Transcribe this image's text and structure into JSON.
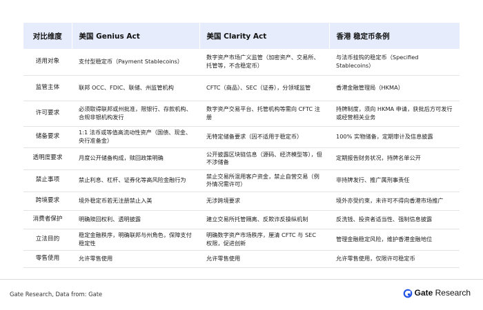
{
  "table": {
    "headers": [
      "对比维度",
      "美国 Genius Act",
      "美国 Clarity Act",
      "香港 稳定币条例"
    ],
    "rows": [
      [
        "适用对象",
        "支付型稳定币（Payment Stablecoins）",
        "数字资产市场广义监管（加密资产、交易所、托管等，不含稳定币）",
        "与法币挂钩的稳定币（Specified Stablecoins）"
      ],
      [
        "监管主体",
        "联邦 OCC、FDIC、联储、州监管机构",
        "CFTC（商品）、SEC（证券），分领域监管",
        "香港金融管理局（HKMA）"
      ],
      [
        "许可要求",
        "必须取得联邦或州批准，限银行、存款机构、合规非银机构发行",
        "数字资产交易平台、托管机构等需向 CFTC 注册",
        "持牌制度，须向 HKMA 申请，获批后方可发行或经营相关业务"
      ],
      [
        "储备要求",
        "1:1 法币或等值高流动性资产（国债、现金、央行准备金）",
        "无特定储备要求（因不适用于稳定币）",
        "100% 实物储备，定期审计及信息披露"
      ],
      [
        "透明度要求",
        "月度公开储备构成，赎回政策明确",
        "公开披露区块链信息（源码、经济模型等），但不涉储备",
        "定期报告财务状况，持牌名单公开"
      ],
      [
        "禁止事项",
        "禁止利息、杠杆、证券化等高风险金融行为",
        "禁止交易所混用客户资金，禁止自营交易（例外情况需许可）",
        "非持牌发行、推广属刑事责任"
      ],
      [
        "跨境要求",
        "境外稳定币若无注册禁止入美",
        "无涉跨境要求",
        "境外亦受约束，未许可不得向香港市场推广"
      ],
      [
        "消费者保护",
        "明确赎回权利、透明披露",
        "建立交易所托管隔离、反欺诈反操纵机制",
        "反洗钱、投资者适当性、强制信息披露"
      ],
      [
        "立法目的",
        "稳定金融秩序，明确联邦与州角色，保障支付稳定性",
        "明确数字资产市场秩序，厘清 CFTC 与 SEC 权限，促进创新",
        "管理金融稳定风险，维护香港金融地位"
      ],
      [
        "零售使用",
        "允许零售使用",
        "允许零售使用",
        "允许零售使用，仅限许可稳定币"
      ]
    ]
  },
  "footer": {
    "source": "Gate Research, Data from:  Gate",
    "brand_name": "Gate",
    "brand_suffix": " Research",
    "brand_icon": "gate-logo-icon",
    "brand_color": "#2354e6"
  }
}
